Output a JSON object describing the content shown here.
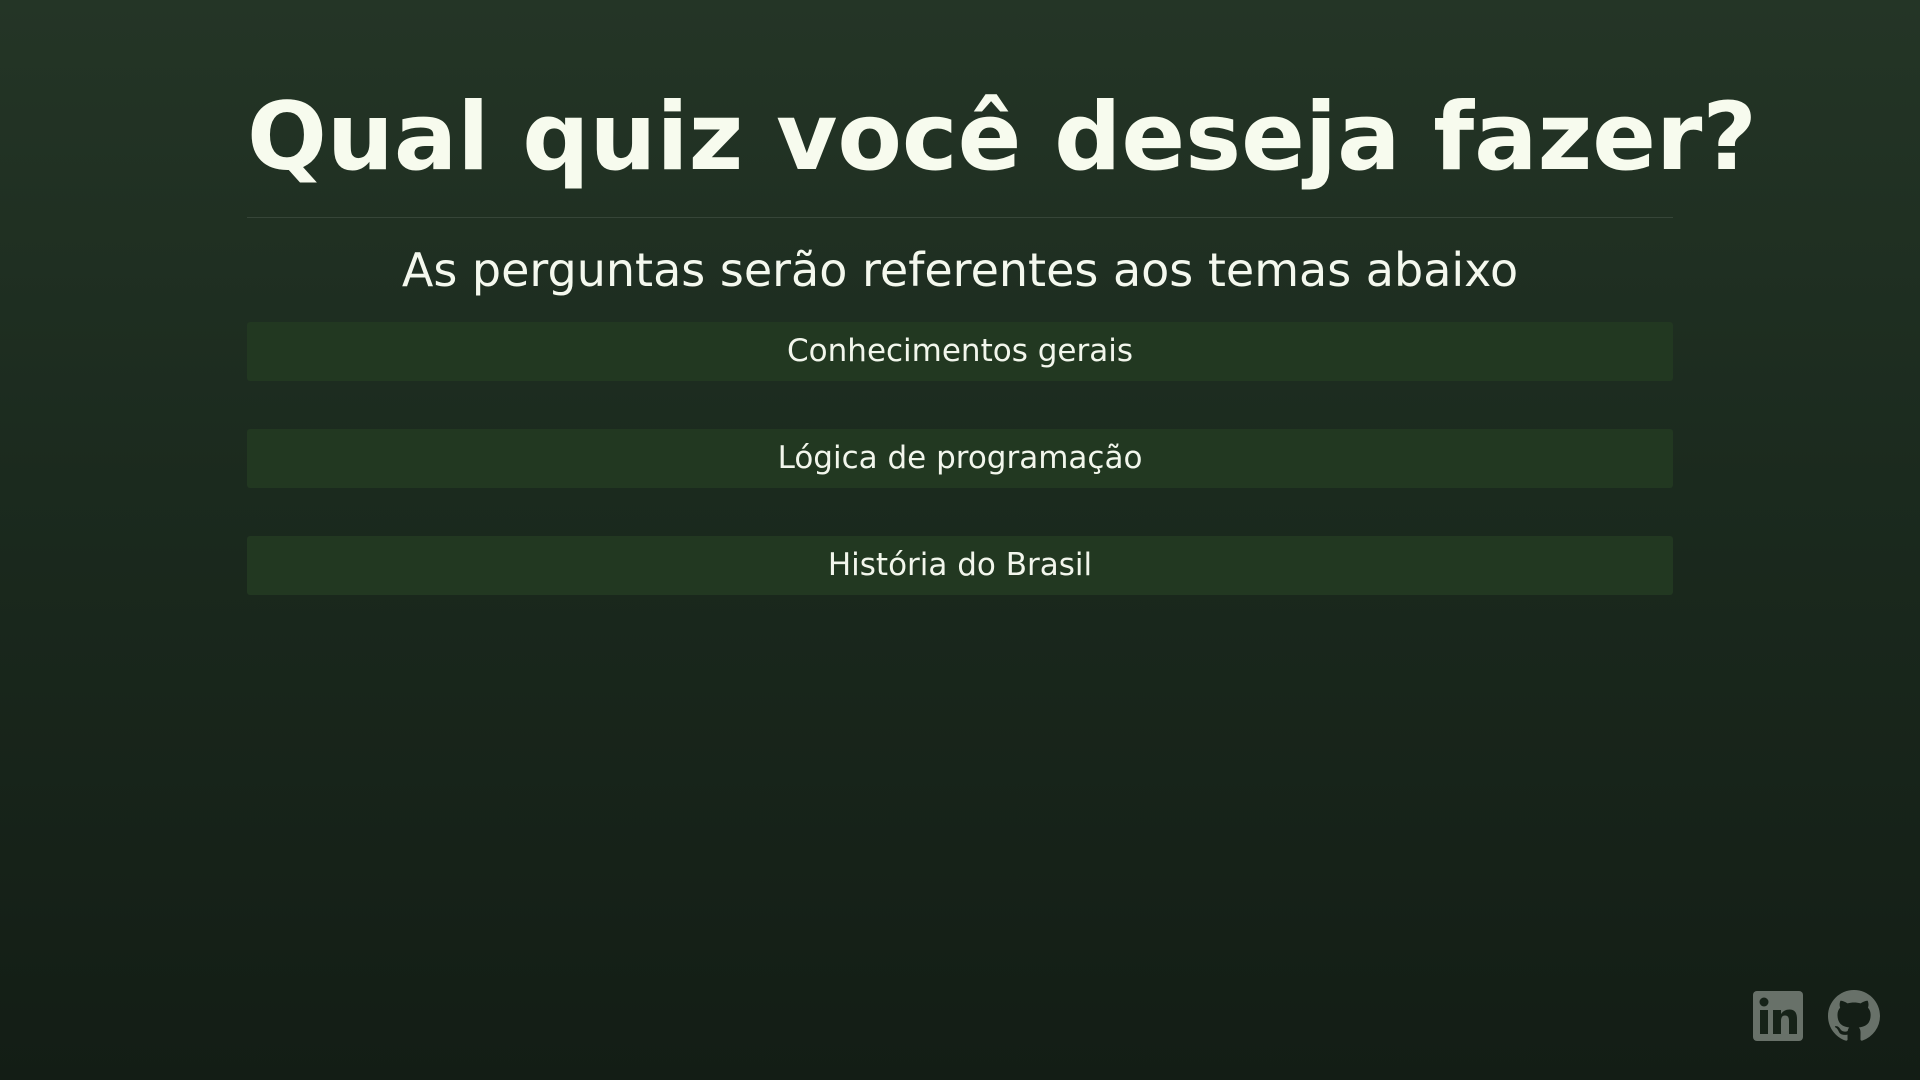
{
  "page": {
    "title": "Qual quiz você deseja fazer?",
    "subtitle": "As perguntas serão referentes aos temas abaixo"
  },
  "quiz_options": [
    {
      "label": "Conhecimentos gerais"
    },
    {
      "label": "Lógica de programação"
    },
    {
      "label": "História do Brasil"
    }
  ],
  "footer": {
    "links": [
      {
        "icon": "linkedin-icon"
      },
      {
        "icon": "github-icon"
      }
    ]
  },
  "colors": {
    "background_top": "#243526",
    "background_bottom": "#131d15",
    "button_background": "#223821",
    "text": "#f6fbef",
    "icon": "#9aa39a"
  }
}
